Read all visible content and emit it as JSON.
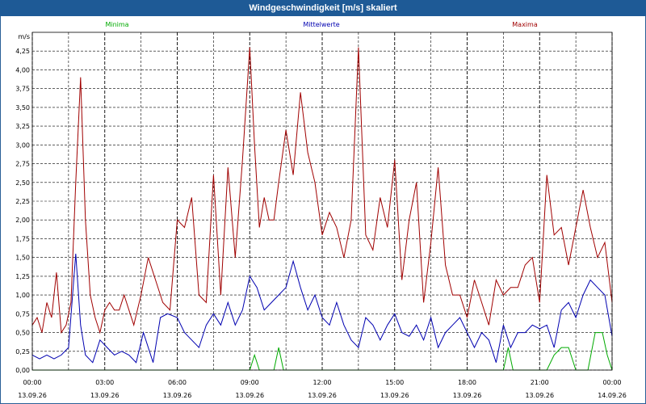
{
  "window": {
    "title": "Windgeschwindigkeit [m/s] skaliert"
  },
  "chart_data": {
    "type": "line",
    "title": "Windgeschwindigkeit [m/s] skaliert",
    "ylabel": "m/s",
    "ylim": [
      0,
      4.5
    ],
    "yticks": [
      "0,00",
      "0,25",
      "0,50",
      "0,75",
      "1,00",
      "1,25",
      "1,50",
      "1,75",
      "2,00",
      "2,25",
      "2,50",
      "2,75",
      "3,00",
      "3,25",
      "3,50",
      "3,75",
      "4,00",
      "4,25"
    ],
    "xlim": [
      0,
      24
    ],
    "xticks": [
      {
        "time": "00:00",
        "date": "13.09.26"
      },
      {
        "time": "03:00",
        "date": "13.09.26"
      },
      {
        "time": "06:00",
        "date": "13.09.26"
      },
      {
        "time": "09:00",
        "date": "13.09.26"
      },
      {
        "time": "12:00",
        "date": "13.09.26"
      },
      {
        "time": "15:00",
        "date": "13.09.26"
      },
      {
        "time": "18:00",
        "date": "13.09.26"
      },
      {
        "time": "21:00",
        "date": "13.09.26"
      },
      {
        "time": "00:00",
        "date": "14.09.26"
      }
    ],
    "grid": true,
    "legend_position": "top",
    "series": [
      {
        "name": "Minima",
        "color": "#00aa00",
        "x": [
          0,
          9.0,
          9.2,
          9.4,
          10.0,
          10.2,
          10.4,
          19.5,
          19.7,
          19.9,
          21.3,
          21.6,
          21.9,
          22.2,
          22.5,
          23.0,
          23.3,
          23.6,
          23.8,
          24.0
        ],
        "values": [
          0,
          0,
          0.2,
          0,
          0,
          0.3,
          0,
          0,
          0.3,
          0,
          0,
          0.2,
          0.3,
          0.3,
          0,
          0,
          0.5,
          0.5,
          0.2,
          0
        ]
      },
      {
        "name": "Mittelwerte",
        "color": "#0000b0",
        "x": [
          0,
          0.3,
          0.6,
          0.9,
          1.2,
          1.5,
          1.8,
          2.0,
          2.2,
          2.5,
          2.8,
          3.1,
          3.4,
          3.7,
          4.0,
          4.3,
          4.6,
          5.0,
          5.3,
          5.6,
          6.0,
          6.3,
          6.6,
          6.9,
          7.2,
          7.5,
          7.8,
          8.1,
          8.4,
          8.7,
          9.0,
          9.3,
          9.6,
          9.9,
          10.2,
          10.5,
          10.8,
          11.1,
          11.4,
          11.7,
          12.0,
          12.3,
          12.6,
          12.9,
          13.2,
          13.5,
          13.8,
          14.1,
          14.4,
          14.7,
          15.0,
          15.3,
          15.6,
          15.9,
          16.2,
          16.5,
          16.8,
          17.1,
          17.4,
          17.7,
          18.0,
          18.3,
          18.6,
          18.9,
          19.2,
          19.5,
          19.8,
          20.1,
          20.4,
          20.7,
          21.0,
          21.3,
          21.6,
          21.9,
          22.2,
          22.5,
          22.8,
          23.1,
          23.4,
          23.7,
          24.0
        ],
        "values": [
          0.2,
          0.15,
          0.2,
          0.15,
          0.2,
          0.3,
          1.55,
          0.6,
          0.2,
          0.1,
          0.4,
          0.3,
          0.2,
          0.25,
          0.2,
          0.1,
          0.5,
          0.1,
          0.7,
          0.75,
          0.7,
          0.5,
          0.4,
          0.3,
          0.6,
          0.75,
          0.6,
          0.9,
          0.6,
          0.8,
          1.25,
          1.1,
          0.8,
          0.9,
          1.0,
          1.1,
          1.45,
          1.1,
          0.8,
          1.0,
          0.7,
          0.6,
          0.9,
          0.6,
          0.4,
          0.3,
          0.7,
          0.6,
          0.4,
          0.6,
          0.75,
          0.5,
          0.45,
          0.6,
          0.4,
          0.7,
          0.3,
          0.5,
          0.6,
          0.7,
          0.5,
          0.3,
          0.5,
          0.4,
          0.1,
          0.6,
          0.3,
          0.5,
          0.5,
          0.6,
          0.55,
          0.6,
          0.3,
          0.8,
          0.9,
          0.7,
          1.0,
          1.2,
          1.1,
          1.0,
          0.45
        ]
      },
      {
        "name": "Maxima",
        "color": "#a00000",
        "x": [
          0,
          0.2,
          0.4,
          0.6,
          0.8,
          1.0,
          1.2,
          1.4,
          1.6,
          1.8,
          2.0,
          2.2,
          2.4,
          2.6,
          2.8,
          3.0,
          3.2,
          3.4,
          3.6,
          3.8,
          4.0,
          4.2,
          4.5,
          4.8,
          5.1,
          5.4,
          5.7,
          6.0,
          6.3,
          6.6,
          6.9,
          7.2,
          7.5,
          7.8,
          8.1,
          8.4,
          8.7,
          9.0,
          9.2,
          9.4,
          9.6,
          9.8,
          10.0,
          10.2,
          10.5,
          10.8,
          11.1,
          11.4,
          11.7,
          12.0,
          12.3,
          12.6,
          12.9,
          13.2,
          13.5,
          13.8,
          14.1,
          14.4,
          14.7,
          15.0,
          15.3,
          15.6,
          15.9,
          16.2,
          16.5,
          16.8,
          17.1,
          17.4,
          17.7,
          18.0,
          18.3,
          18.6,
          18.9,
          19.2,
          19.5,
          19.8,
          20.1,
          20.4,
          20.7,
          21.0,
          21.3,
          21.6,
          21.9,
          22.2,
          22.5,
          22.8,
          23.1,
          23.4,
          23.7,
          24.0
        ],
        "values": [
          0.6,
          0.7,
          0.5,
          0.9,
          0.7,
          1.3,
          0.5,
          0.6,
          0.9,
          2.5,
          3.9,
          2.0,
          1.0,
          0.7,
          0.5,
          0.8,
          0.9,
          0.8,
          0.8,
          1.0,
          0.8,
          0.6,
          1.0,
          1.5,
          1.2,
          0.9,
          0.8,
          2.0,
          1.9,
          2.3,
          1.0,
          0.9,
          2.6,
          1.0,
          2.7,
          1.5,
          2.8,
          4.3,
          3.0,
          1.9,
          2.3,
          2.0,
          2.0,
          2.5,
          3.2,
          2.6,
          3.7,
          2.9,
          2.5,
          1.8,
          2.1,
          1.9,
          1.5,
          2.0,
          4.3,
          1.8,
          1.6,
          2.3,
          1.9,
          2.8,
          1.2,
          2.0,
          2.5,
          0.9,
          1.7,
          2.7,
          1.4,
          1.0,
          1.0,
          0.7,
          1.2,
          0.9,
          0.6,
          1.2,
          1.0,
          1.1,
          1.1,
          1.4,
          1.5,
          0.9,
          2.6,
          1.8,
          1.9,
          1.4,
          1.9,
          2.4,
          1.9,
          1.5,
          1.7,
          0.9
        ]
      }
    ]
  }
}
